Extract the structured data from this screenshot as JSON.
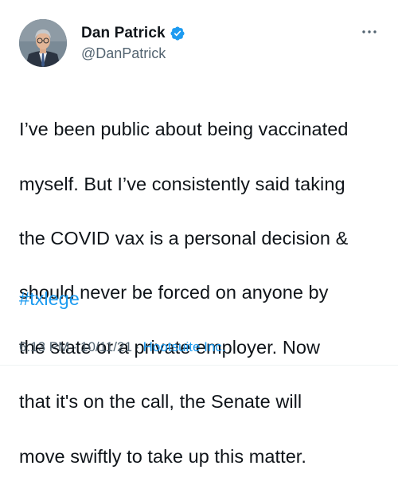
{
  "author": {
    "display_name": "Dan Patrick",
    "handle": "@DanPatrick",
    "verified": true
  },
  "tweet": {
    "text_lines": [
      "I’ve been public about being vaccinated",
      "myself. But I’ve consistently said taking",
      "the COVID vax is a personal decision &",
      "should never be forced on anyone by",
      "the state or a private employer. Now",
      "that it's on the call, the Senate will",
      "move swiftly to take up this matter."
    ],
    "hashtag": "#txlege"
  },
  "meta": {
    "time": "6:13 PM",
    "separator": "·",
    "date": "10/11/21",
    "source": "Hootsuite Inc."
  },
  "colors": {
    "text": "#0f1419",
    "secondary": "#536471",
    "link": "#1d9bf0"
  },
  "icons": {
    "verified": "verified-badge-icon",
    "more": "more-options-icon"
  }
}
